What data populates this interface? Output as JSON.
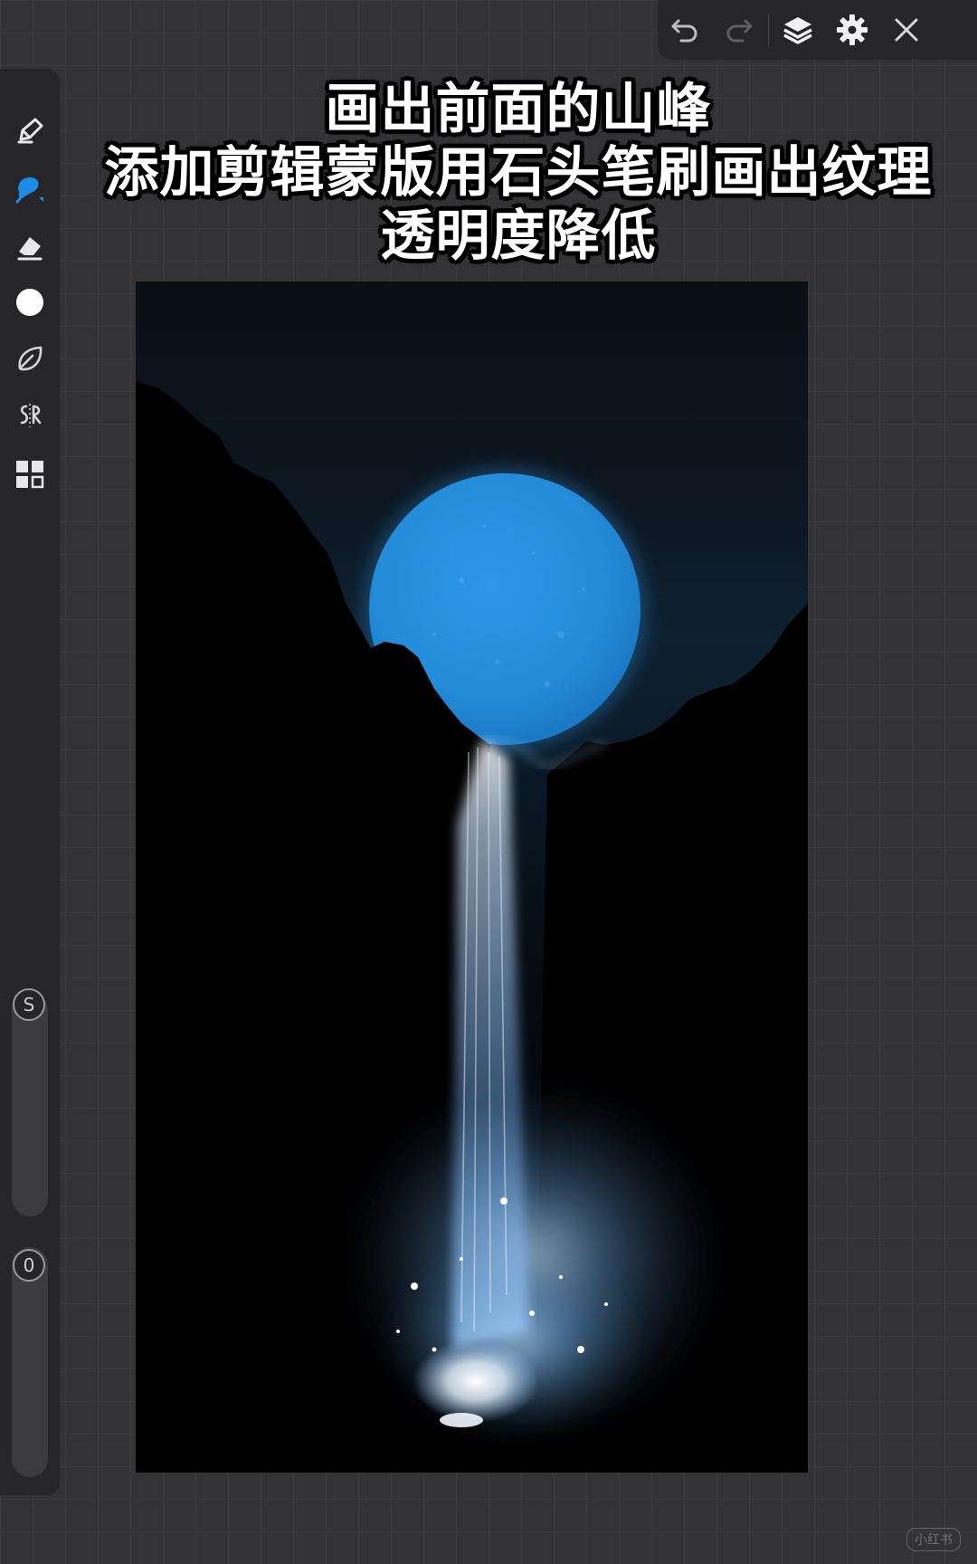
{
  "caption": {
    "line1": "画出前面的山峰",
    "line2": "添加剪辑蒙版用石头笔刷画出纹理",
    "line3": "透明度降低"
  },
  "toolbar": {
    "icons": [
      "undo-icon",
      "redo-icon",
      "layers-icon",
      "gear-icon",
      "close-icon"
    ]
  },
  "tools": {
    "icons": [
      "pencil-icon",
      "smudge-brush-icon",
      "eraser-icon",
      "color-circle-icon",
      "leaf-icon",
      "symmetry-icon",
      "widgets-icon"
    ],
    "active": "smudge-brush-icon"
  },
  "sliders": {
    "size_label": "S",
    "opacity_label": "0"
  },
  "colors": {
    "accent": "#1e8be8",
    "moon": "#2a93e0",
    "sky_top": "#0b1722",
    "ui_panel": "#262628",
    "background": "#333335"
  },
  "watermark": "小红书"
}
